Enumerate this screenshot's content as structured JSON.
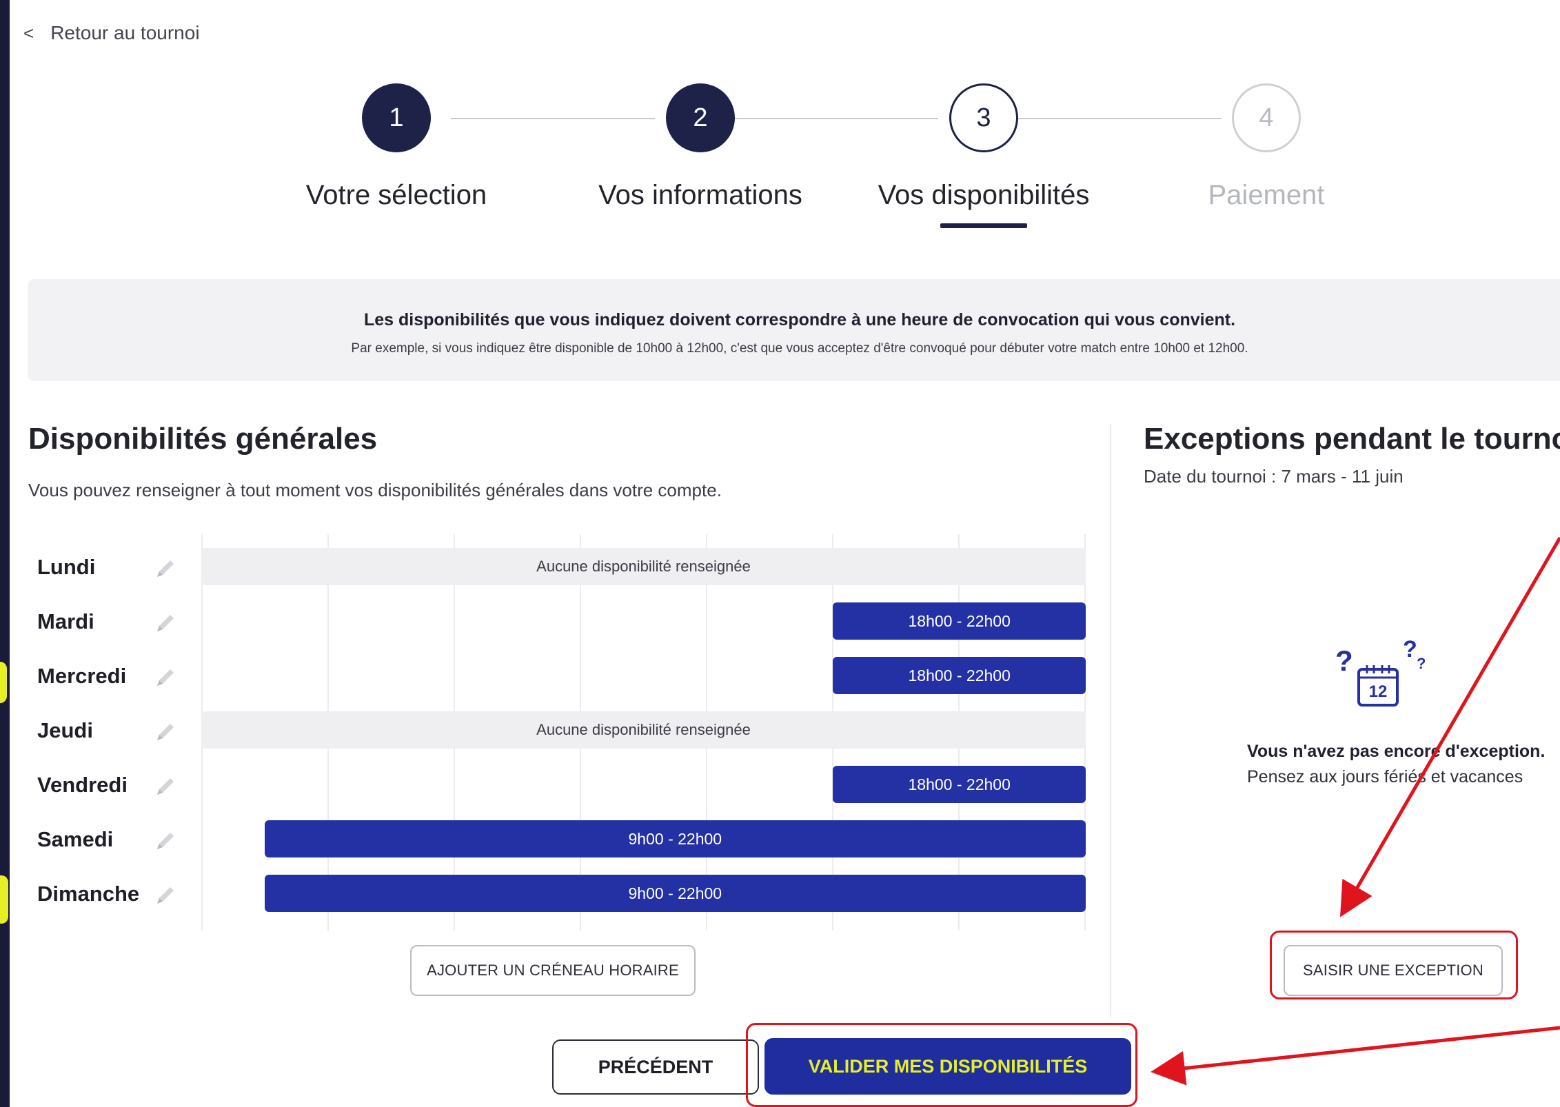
{
  "back_link": {
    "label": "Retour au tournoi"
  },
  "stepper": [
    {
      "number": "1",
      "label": "Votre sélection",
      "state": "done"
    },
    {
      "number": "2",
      "label": "Vos informations",
      "state": "done"
    },
    {
      "number": "3",
      "label": "Vos disponibilités",
      "state": "current"
    },
    {
      "number": "4",
      "label": "Paiement",
      "state": "todo"
    }
  ],
  "info": {
    "title": "Les disponibilités que vous indiquez doivent correspondre à une heure de convocation qui vous convient.",
    "subtitle": "Par exemple, si vous indiquez être disponible de 10h00 à 12h00, c'est que vous acceptez d'être convoqué pour débuter votre match entre 10h00 et 12h00."
  },
  "general": {
    "title": "Disponibilités générales",
    "subtitle": "Vous pouvez renseigner à tout moment vos disponibilités générales dans votre compte.",
    "days": [
      {
        "name": "Lundi",
        "slot": "Aucune disponibilité renseignée",
        "start": 8,
        "end": 22,
        "empty": true
      },
      {
        "name": "Mardi",
        "slot": "18h00 - 22h00",
        "start": 18,
        "end": 22,
        "empty": false
      },
      {
        "name": "Mercredi",
        "slot": "18h00 - 22h00",
        "start": 18,
        "end": 22,
        "empty": false
      },
      {
        "name": "Jeudi",
        "slot": "Aucune disponibilité renseignée",
        "start": 8,
        "end": 22,
        "empty": true
      },
      {
        "name": "Vendredi",
        "slot": "18h00 - 22h00",
        "start": 18,
        "end": 22,
        "empty": false
      },
      {
        "name": "Samedi",
        "slot": "9h00 - 22h00",
        "start": 9,
        "end": 22,
        "empty": false
      },
      {
        "name": "Dimanche",
        "slot": "9h00 - 22h00",
        "start": 9,
        "end": 22,
        "empty": false
      }
    ],
    "add_slot_label": "AJOUTER UN CRÉNEAU HORAIRE"
  },
  "exceptions": {
    "title": "Exceptions pendant le tournoi",
    "dates": "Date du tournoi : 7 mars - 11 juin",
    "calendar_day": "12",
    "empty_title": "Vous n'avez pas encore d'exception.",
    "empty_hint": "Pensez aux jours fériés et vacances",
    "add_label": "SAISIR UNE EXCEPTION"
  },
  "footer": {
    "prev_label": "PRÉCÉDENT",
    "validate_label": "VALIDER MES DISPONIBILITÉS"
  },
  "colors": {
    "navy": "#1e2249",
    "slot_blue": "#2431a5",
    "accent_yellow": "#e6f024",
    "highlight_red": "#e0141c"
  }
}
